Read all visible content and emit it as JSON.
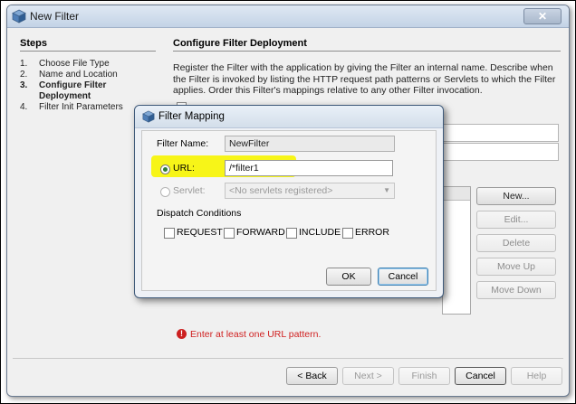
{
  "window": {
    "title": "New Filter",
    "close_glyph": "✕"
  },
  "steps": {
    "heading": "Steps",
    "items": [
      {
        "num": "1.",
        "label": "Choose File Type"
      },
      {
        "num": "2.",
        "label": "Name and Location"
      },
      {
        "num": "3.",
        "label": "Configure Filter Deployment",
        "active": true
      },
      {
        "num": "4.",
        "label": "Filter Init Parameters"
      }
    ]
  },
  "main": {
    "heading": "Configure Filter Deployment",
    "description": "Register the Filter with the application by giving the Filter an internal name. Describe when the Filter is invoked by listing the HTTP request path patterns or Servlets to which the Filter applies. Order this Filter's mappings relative to any other Filter invocation.",
    "side_buttons": {
      "new": "New...",
      "edit": "Edit...",
      "delete": "Delete",
      "move_up": "Move Up",
      "move_down": "Move Down"
    },
    "error": "Enter at least one URL pattern."
  },
  "footer": {
    "back": "< Back",
    "next": "Next >",
    "finish": "Finish",
    "cancel": "Cancel",
    "help": "Help"
  },
  "dialog": {
    "title": "Filter Mapping",
    "filter_name_label": "Filter Name:",
    "filter_name_value": "NewFilter",
    "url_label": "URL:",
    "url_value": "/*filter1",
    "servlet_label": "Servlet:",
    "servlet_value": "<No servlets registered>",
    "dispatch_label": "Dispatch Conditions",
    "conditions": [
      "REQUEST",
      "FORWARD",
      "INCLUDE",
      "ERROR"
    ],
    "ok": "OK",
    "cancel": "Cancel"
  },
  "colors": {
    "highlight": "#f7f500",
    "error": "#d02020",
    "radio_selected": "#2e7d32"
  },
  "icons": {
    "window": "cube-icon",
    "dialog": "cube-icon",
    "error": "error-icon"
  }
}
